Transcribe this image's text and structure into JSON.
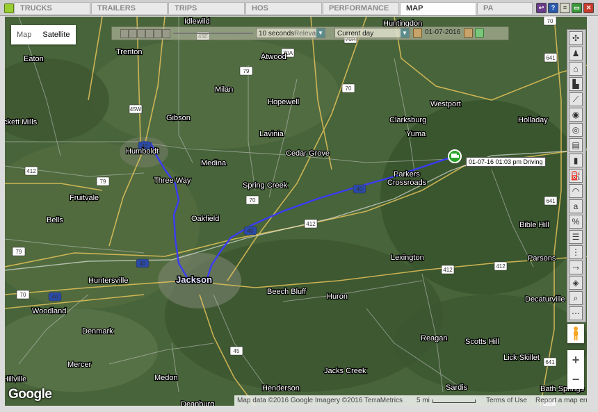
{
  "tabs": [
    {
      "label": "TRUCKS"
    },
    {
      "label": "TRAILERS"
    },
    {
      "label": "TRIPS"
    },
    {
      "label": "HOS"
    },
    {
      "label": "PERFORMANCE"
    },
    {
      "label": "MAP"
    },
    {
      "label": "PA"
    }
  ],
  "active_tab": "MAP",
  "map_type": {
    "map_label": "Map",
    "satellite_label": "Satellite",
    "selected": "Satellite"
  },
  "playback": {
    "speed": "10 seconds",
    "relevant": "Relevant",
    "day": "Current day",
    "date": "01-07-2016"
  },
  "vehicle": {
    "label": "01-07-16 01:03 pm Driving"
  },
  "places": [
    {
      "name": "Idlewild"
    },
    {
      "name": "Trenton"
    },
    {
      "name": "Eaton"
    },
    {
      "name": "Atwood"
    },
    {
      "name": "Huntingdon"
    },
    {
      "name": "Milan"
    },
    {
      "name": "Hopewell"
    },
    {
      "name": "Westport"
    },
    {
      "name": "Gibson"
    },
    {
      "name": "Clarksburg"
    },
    {
      "name": "Holladay"
    },
    {
      "name": "ckett Mills"
    },
    {
      "name": "Lavinia"
    },
    {
      "name": "Yuma"
    },
    {
      "name": "Humboldt"
    },
    {
      "name": "Cedar Grove"
    },
    {
      "name": "Medina"
    },
    {
      "name": "Parkers"
    },
    {
      "name": "Crossroads"
    },
    {
      "name": "Three Way"
    },
    {
      "name": "Spring Creek"
    },
    {
      "name": "Fruitvale"
    },
    {
      "name": "Oakfield"
    },
    {
      "name": "Bells"
    },
    {
      "name": "Bible Hill"
    },
    {
      "name": "Lexington"
    },
    {
      "name": "Parsons"
    },
    {
      "name": "Huntersville"
    },
    {
      "name": "Jackson"
    },
    {
      "name": "Beech Bluff"
    },
    {
      "name": "Decaturville"
    },
    {
      "name": "Woodland"
    },
    {
      "name": "Huron"
    },
    {
      "name": "Denmark"
    },
    {
      "name": "Reagan"
    },
    {
      "name": "Scotts Hill"
    },
    {
      "name": "Lick Skillet"
    },
    {
      "name": "Mercer"
    },
    {
      "name": "Jacks Creek"
    },
    {
      "name": "Medon"
    },
    {
      "name": "Sardis"
    },
    {
      "name": "Hillville"
    },
    {
      "name": "Henderson"
    },
    {
      "name": "Bath Springs"
    },
    {
      "name": "Deanburg"
    }
  ],
  "shields": [
    "45E",
    "70A",
    "70A",
    "79",
    "70",
    "45W",
    "70",
    "40",
    "412",
    "79",
    "40",
    "70",
    "412",
    "40",
    "641",
    "40",
    "412",
    "412",
    "79",
    "40",
    "70",
    "45",
    "641",
    "641",
    "70"
  ],
  "attribution": {
    "data": "Map data ©2016 Google Imagery ©2016 TerraMetrics",
    "scale": "5 mi",
    "terms": "Terms of Use",
    "report": "Report a map error"
  },
  "logo": "Google",
  "zoom": {
    "in": "+",
    "out": "−"
  },
  "colors": {
    "route": "#3a3aff",
    "vehicle_marker": "#2aa52a",
    "active_tab_bg": "#fdfdfd"
  }
}
